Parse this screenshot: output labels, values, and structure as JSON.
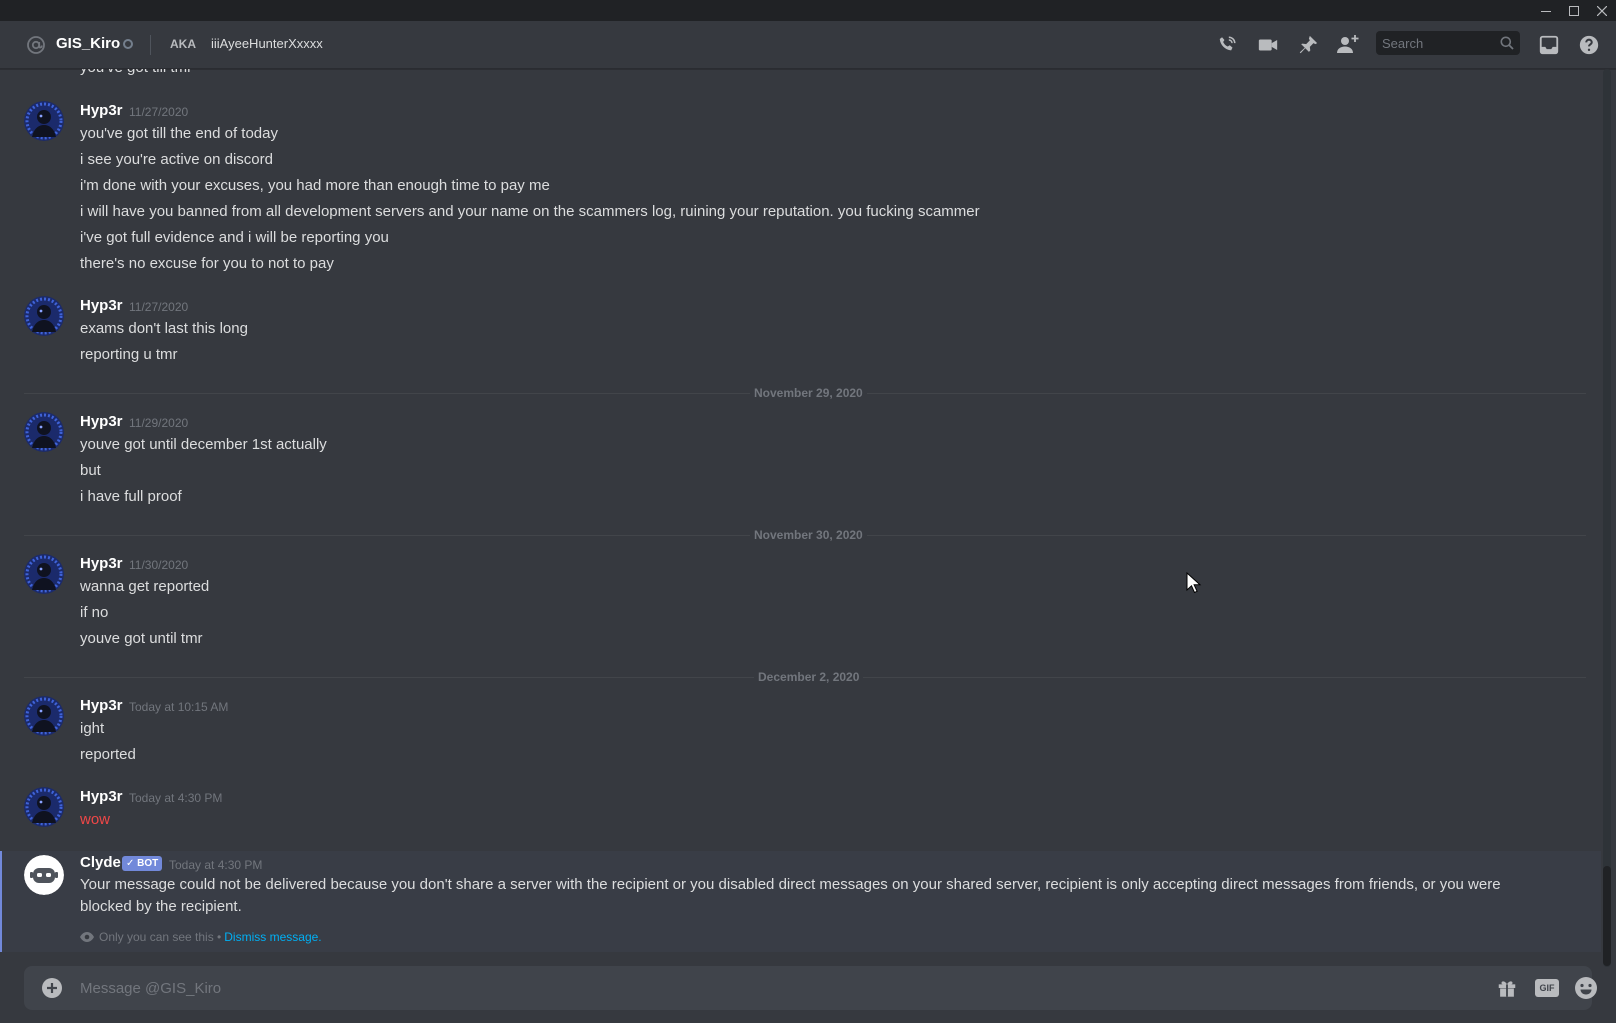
{
  "header": {
    "username": "GIS_Kiro",
    "aka_label": "AKA",
    "nickname": "iiiAyeeHunterXxxxx",
    "search_placeholder": "Search"
  },
  "messages": {
    "cutoff_line": "you've got till tmr",
    "groups": [
      {
        "author": "Hyp3r",
        "timestamp": "11/27/2020",
        "lines": [
          "you've got till the end of today",
          "i see you're active on discord",
          "i'm done with your excuses, you had more than enough time to pay me",
          "i will have you banned from all development servers and your name on the scammers log, ruining your reputation. you fucking scammer",
          "i've got full evidence and i will be reporting you",
          "there's no excuse for you to not to pay"
        ]
      },
      {
        "author": "Hyp3r",
        "timestamp": "11/27/2020",
        "lines": [
          "exams don't last this long",
          "reporting u tmr"
        ]
      },
      {
        "author": "Hyp3r",
        "timestamp": "11/29/2020",
        "lines": [
          "youve got until december 1st actually",
          "but",
          "i have full proof"
        ]
      },
      {
        "author": "Hyp3r",
        "timestamp": "11/30/2020",
        "lines": [
          "wanna get reported",
          "if no",
          "youve got until tmr"
        ]
      },
      {
        "author": "Hyp3r",
        "timestamp": "Today at 10:15 AM",
        "lines": [
          "ight",
          "reported"
        ]
      },
      {
        "author": "Hyp3r",
        "timestamp": "Today at 4:30 PM",
        "lines": [
          "wow"
        ]
      }
    ],
    "dividers": [
      "November 29, 2020",
      "November 30, 2020",
      "December 2, 2020"
    ],
    "clyde": {
      "author": "Clyde",
      "bot_tag": "✓ BOT",
      "timestamp": "Today at 4:30 PM",
      "text": "Your message could not be delivered because you don't share a server with the recipient or you disabled direct messages on your shared server, recipient is only accepting direct messages from friends, or you were blocked by the recipient.",
      "only_you": "Only you can see this •",
      "dismiss": "Dismiss message."
    }
  },
  "composer": {
    "placeholder": "Message @GIS_Kiro",
    "gif_label": "GIF"
  },
  "colors": {
    "background": "#36393f",
    "accent": "#7289da",
    "error_text": "#f04747",
    "link": "#00b0f4"
  },
  "icons": [
    "at-icon",
    "status-offline-icon",
    "call-icon",
    "video-icon",
    "pin-icon",
    "add-friend-icon",
    "search-icon",
    "inbox-icon",
    "help-icon",
    "add-attachment-icon",
    "gift-icon",
    "gif-icon",
    "emoji-icon",
    "eye-icon",
    "minimize-icon",
    "maximize-icon",
    "close-icon"
  ]
}
